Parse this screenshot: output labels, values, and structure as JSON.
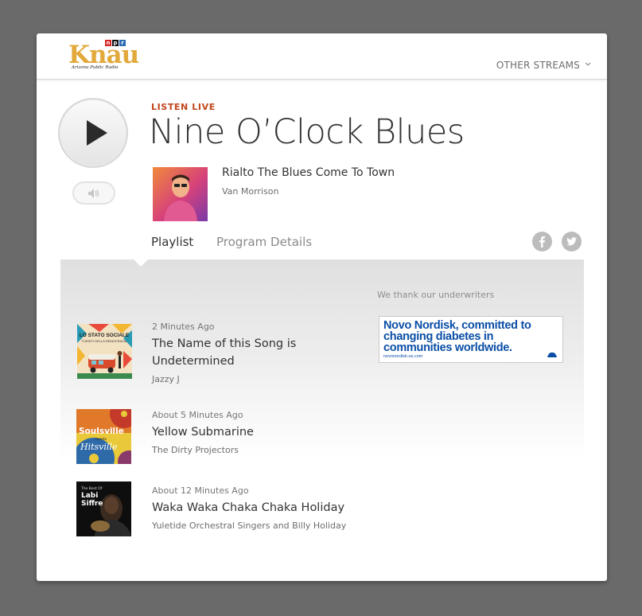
{
  "header": {
    "logo": {
      "wordmark": "Knau",
      "npr_letters": [
        "n",
        "p",
        "r"
      ],
      "subtitle": "Arizona Public Radio"
    },
    "other_streams_label": "OTHER STREAMS",
    "other_streams_icon": "chevron-down-icon"
  },
  "player": {
    "play_icon": "play-icon",
    "volume_icon": "volume-icon",
    "status_label": "LISTEN LIVE",
    "show_title": "Nine O’Clock Blues",
    "now_playing": {
      "song": "Rialto The Blues Come To Town",
      "artist": "Van Morrison"
    }
  },
  "tabs": [
    {
      "label": "Playlist",
      "active": true
    },
    {
      "label": "Program Details",
      "active": false
    }
  ],
  "social": [
    "facebook-icon",
    "twitter-icon"
  ],
  "underwriting": {
    "heading": "We thank our underwriters",
    "ad_lines": [
      "Novo Nordisk, committed to",
      "changing diabetes in",
      "communities worldwide."
    ],
    "ad_url": "novonordisk-us.com"
  },
  "playlist": [
    {
      "time": "2 Minutes Ago",
      "title": "The Name of this Song is Undetermined",
      "artist": "Jazzy J"
    },
    {
      "time": "About 5 Minutes Ago",
      "title": "Yellow Submarine",
      "artist": "The Dirty Projectors"
    },
    {
      "time": "About 12 Minutes Ago",
      "title": "Waka Waka Chaka Chaka Holiday",
      "artist": "Yuletide Orchestral Singers and Billy Holiday"
    }
  ],
  "album_art_text": {
    "item1": [
      "LO STATO SOCIALE",
      "TURISTI DELLA DEMOCRAZIA"
    ],
    "item2": [
      "Soulsville",
      "meets",
      "Hitsville"
    ],
    "item3": [
      "The Best Of",
      "Labi",
      "Siffre"
    ]
  },
  "colors": {
    "accent": "#c0461c",
    "logo_gold": "#e2a93c",
    "npr_red": "#d62021",
    "npr_black": "#111111",
    "npr_blue": "#2b6bb3",
    "ad_blue": "#0a4ea6",
    "background": "#6a6a6a"
  }
}
